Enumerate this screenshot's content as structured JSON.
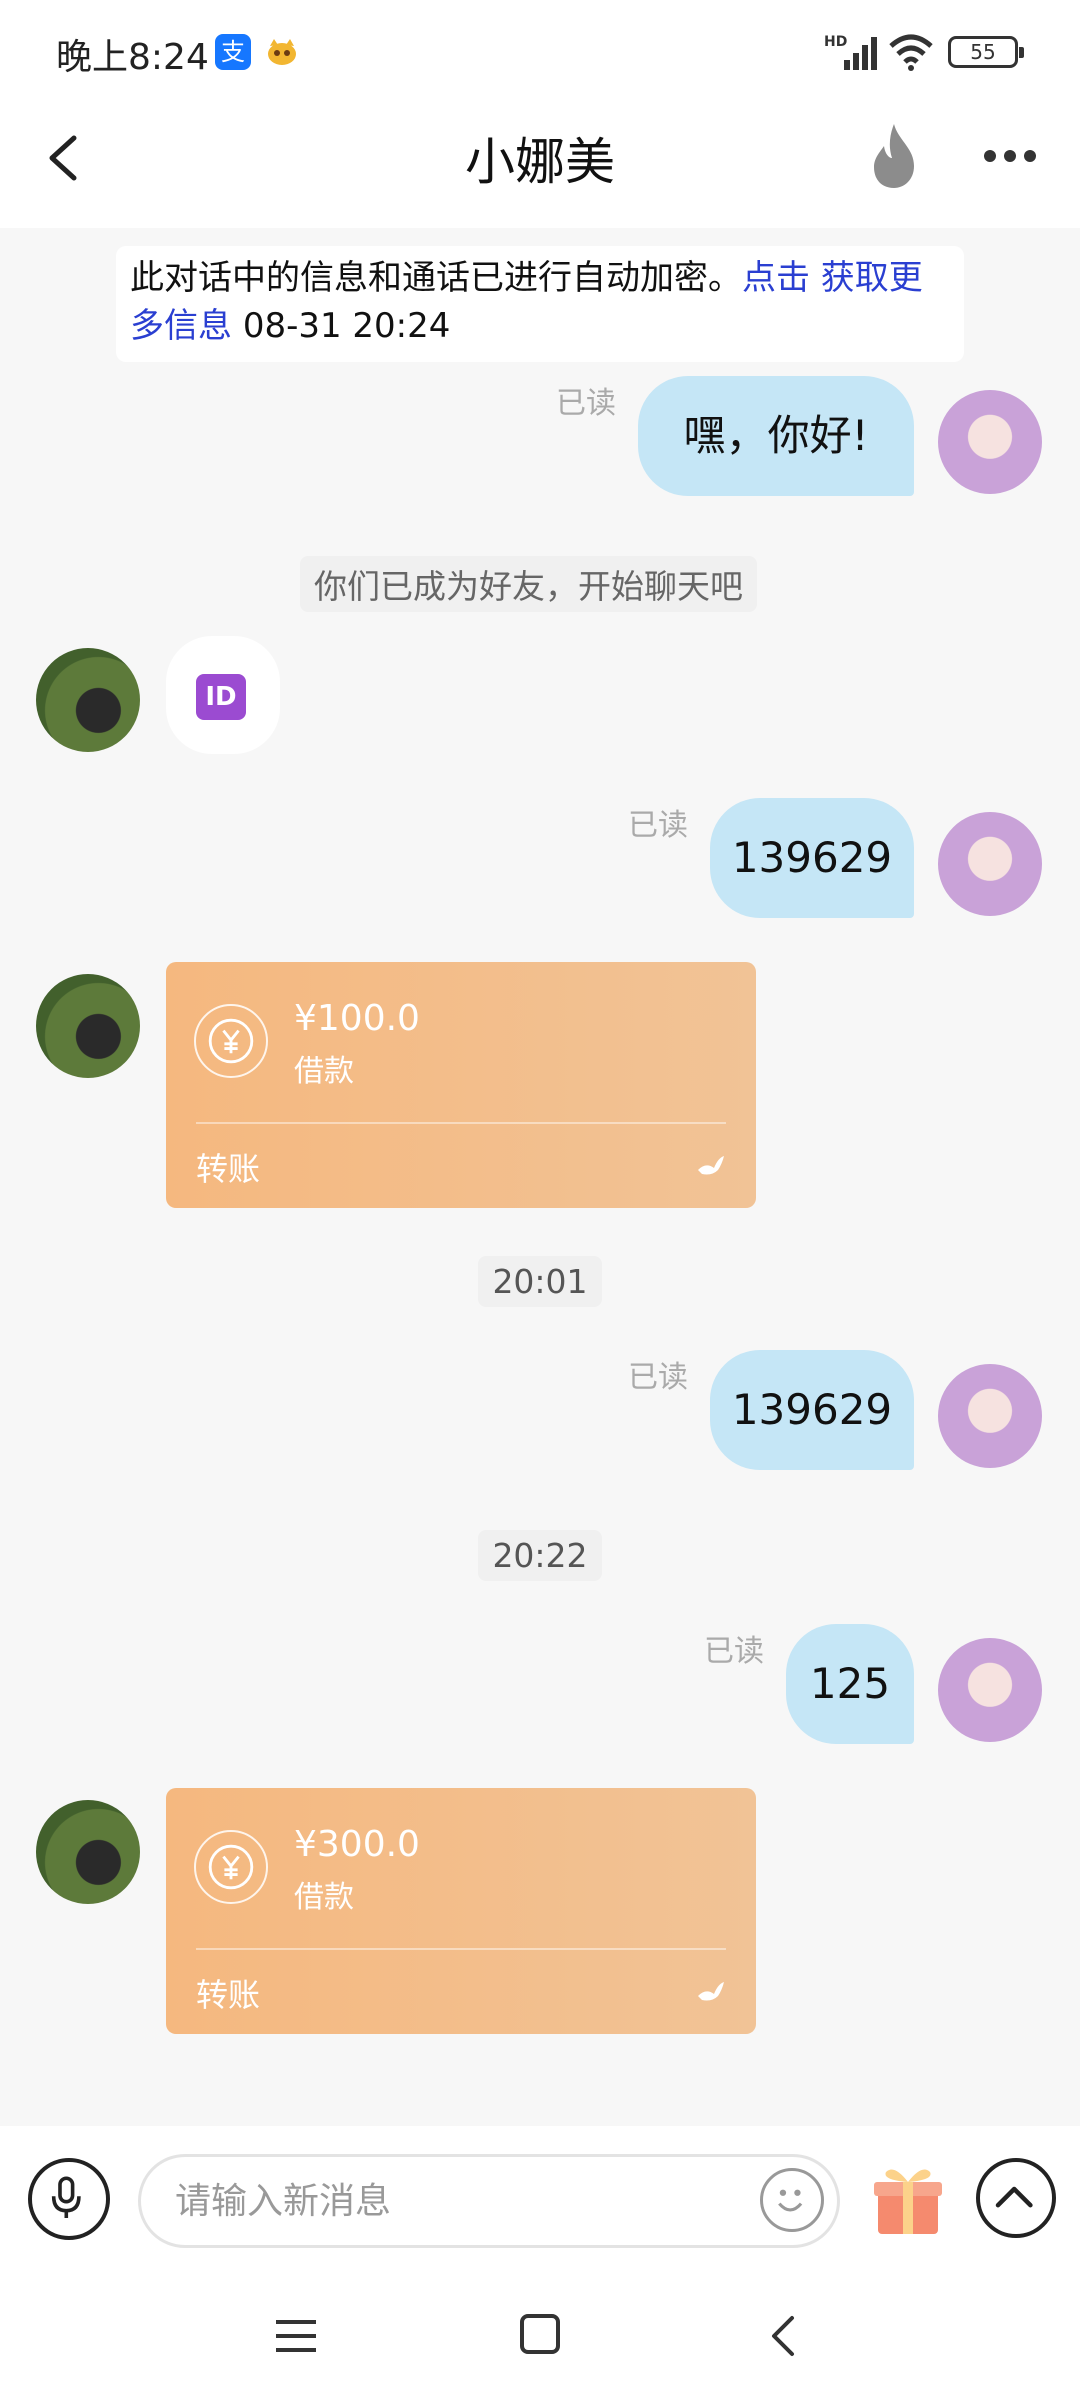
{
  "status_bar": {
    "time": "晚上8:24",
    "alipay_glyph": "支",
    "network_badge": "HD",
    "battery": "55",
    "icons": [
      "alipay-icon",
      "app-mascot-icon",
      "signal-icon",
      "wifi-icon",
      "battery-icon"
    ]
  },
  "header": {
    "title": "小娜美",
    "icons": [
      "back-arrow-icon",
      "fire-icon",
      "more-dots-icon"
    ]
  },
  "notice": {
    "text": "此对话中的信息和通话已进行自动加密。",
    "link": "点击 获取更多信息",
    "time": "08-31 20:24"
  },
  "messages": {
    "m1": {
      "text": "嘿，你好!",
      "status": "已读"
    },
    "friend_notice": "你们已成为好友，开始聊天吧",
    "id_emoji": "ID",
    "m2": {
      "text": "139629",
      "status": "已读"
    },
    "transfer1": {
      "amount": "¥100.0",
      "note": "借款",
      "label": "转账"
    },
    "time1": "20:01",
    "m3": {
      "text": "139629",
      "status": "已读"
    },
    "time2": "20:22",
    "m4": {
      "text": "125",
      "status": "已读"
    },
    "transfer2": {
      "amount": "¥300.0",
      "note": "借款",
      "label": "转账"
    }
  },
  "input_bar": {
    "placeholder": "请输入新消息",
    "icons": [
      "microphone-icon",
      "emoji-icon",
      "gift-icon",
      "chevron-up-icon"
    ]
  },
  "nav_bar": {
    "icons": [
      "menu-icon",
      "home-icon",
      "back-icon"
    ]
  },
  "colors": {
    "my_bubble": "#c5e6f6",
    "transfer_card": "#f5b87f",
    "link": "#2a3fd1",
    "background": "#f7f7f7"
  }
}
